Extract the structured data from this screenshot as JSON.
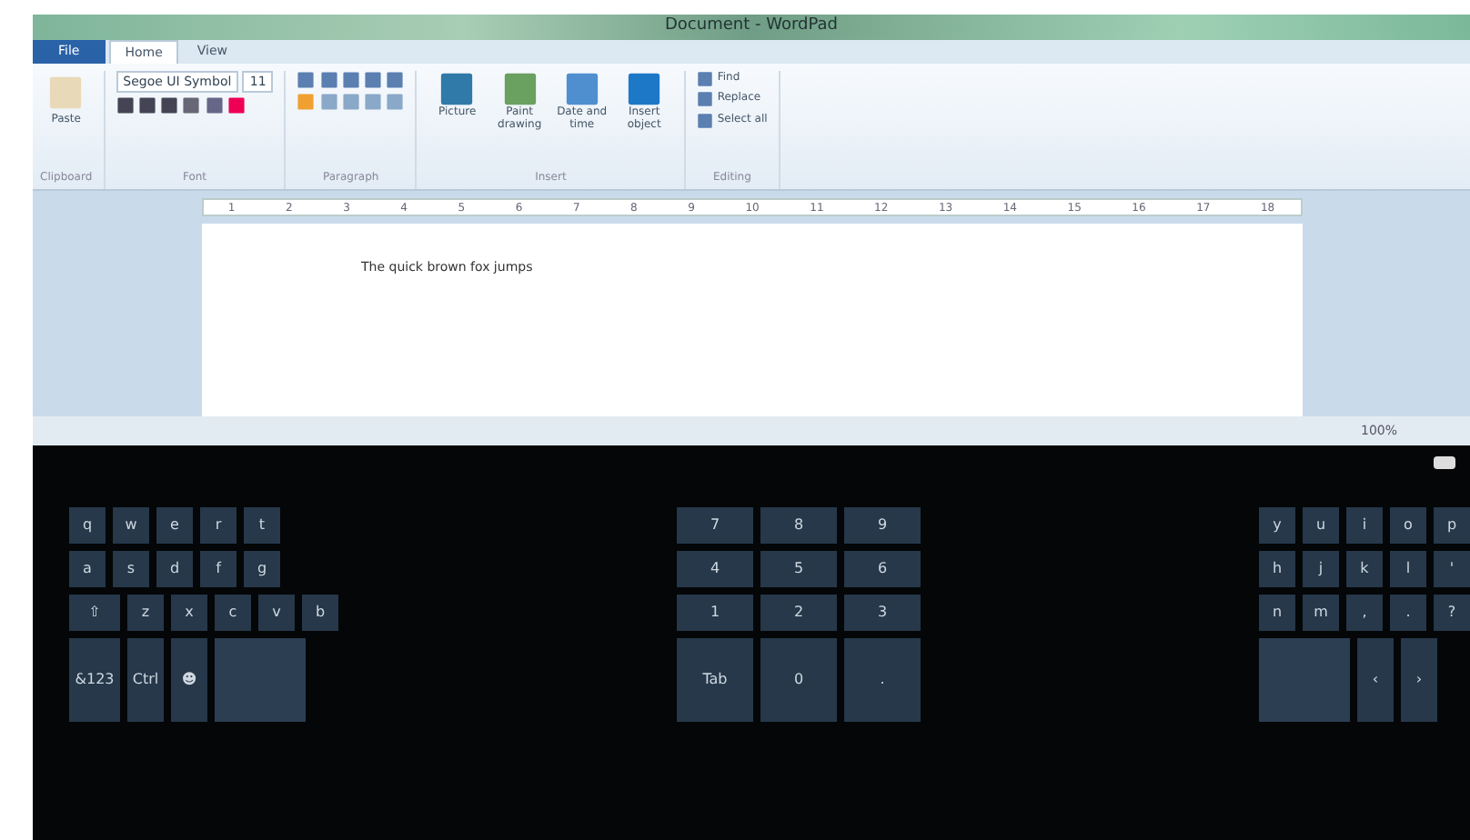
{
  "window": {
    "title": "Document - WordPad"
  },
  "tabs": [
    {
      "label": "File",
      "selected": false,
      "kind": "file"
    },
    {
      "label": "Home",
      "selected": true,
      "kind": "tab"
    },
    {
      "label": "View",
      "selected": false,
      "kind": "tab"
    }
  ],
  "ribbon": {
    "paste": "Paste",
    "font_name": "Segoe UI Symbol",
    "font_size": "11",
    "insert": [
      "Picture",
      "Paint drawing",
      "Date and time",
      "Insert object"
    ],
    "editing": [
      "Find",
      "Replace",
      "Select all"
    ],
    "groups": [
      "Clipboard",
      "Font",
      "Paragraph",
      "Insert",
      "Editing"
    ]
  },
  "ruler": [
    "1",
    "2",
    "3",
    "4",
    "5",
    "6",
    "7",
    "8",
    "9",
    "10",
    "11",
    "12",
    "13",
    "14",
    "15",
    "16",
    "17",
    "18"
  ],
  "document": {
    "text": "The quick brown fox jumps"
  },
  "status_bar": {
    "zoom": "100%"
  },
  "keyboard": {
    "left": [
      [
        {
          "label": "q",
          "kind": "char"
        },
        {
          "label": "w",
          "kind": "char"
        },
        {
          "label": "e",
          "kind": "char"
        },
        {
          "label": "r",
          "kind": "char"
        },
        {
          "label": "t",
          "kind": "char"
        }
      ],
      [
        {
          "label": "a",
          "kind": "char"
        },
        {
          "label": "s",
          "kind": "char"
        },
        {
          "label": "d",
          "kind": "char"
        },
        {
          "label": "f",
          "kind": "char"
        },
        {
          "label": "g",
          "kind": "char"
        }
      ],
      [
        {
          "label": "⇧",
          "kind": "wide"
        },
        {
          "label": "z",
          "kind": "char"
        },
        {
          "label": "x",
          "kind": "char"
        },
        {
          "label": "c",
          "kind": "char"
        },
        {
          "label": "v",
          "kind": "char"
        },
        {
          "label": "b",
          "kind": "char"
        }
      ],
      [
        {
          "label": "&123",
          "kind": "wide"
        },
        {
          "label": "Ctrl",
          "kind": "char"
        },
        {
          "label": "☻",
          "kind": "char"
        },
        {
          "kind": "space"
        }
      ]
    ],
    "middle": [
      [
        {
          "label": "7",
          "kind": "num"
        },
        {
          "label": "8",
          "kind": "num"
        },
        {
          "label": "9",
          "kind": "num"
        }
      ],
      [
        {
          "label": "4",
          "kind": "num"
        },
        {
          "label": "5",
          "kind": "num"
        },
        {
          "label": "6",
          "kind": "num"
        }
      ],
      [
        {
          "label": "1",
          "kind": "num"
        },
        {
          "label": "2",
          "kind": "num"
        },
        {
          "label": "3",
          "kind": "num"
        }
      ],
      [
        {
          "label": "Tab",
          "kind": "num"
        },
        {
          "label": "0",
          "kind": "num"
        },
        {
          "label": ".",
          "kind": "num"
        }
      ]
    ],
    "right": [
      [
        {
          "label": "y",
          "kind": "char"
        },
        {
          "label": "u",
          "kind": "char"
        },
        {
          "label": "i",
          "kind": "char"
        },
        {
          "label": "o",
          "kind": "char"
        },
        {
          "label": "p",
          "kind": "char"
        }
      ],
      [
        {
          "label": "h",
          "kind": "char"
        },
        {
          "label": "j",
          "kind": "char"
        },
        {
          "label": "k",
          "kind": "char"
        },
        {
          "label": "l",
          "kind": "char"
        },
        {
          "label": "'",
          "kind": "char"
        }
      ],
      [
        {
          "label": "n",
          "kind": "char"
        },
        {
          "label": "m",
          "kind": "char"
        },
        {
          "label": ",",
          "kind": "char"
        },
        {
          "label": ".",
          "kind": "char"
        },
        {
          "label": "?",
          "kind": "char"
        }
      ],
      [
        {
          "kind": "space"
        },
        {
          "label": "‹",
          "kind": "char"
        },
        {
          "label": "›",
          "kind": "char"
        }
      ]
    ]
  }
}
